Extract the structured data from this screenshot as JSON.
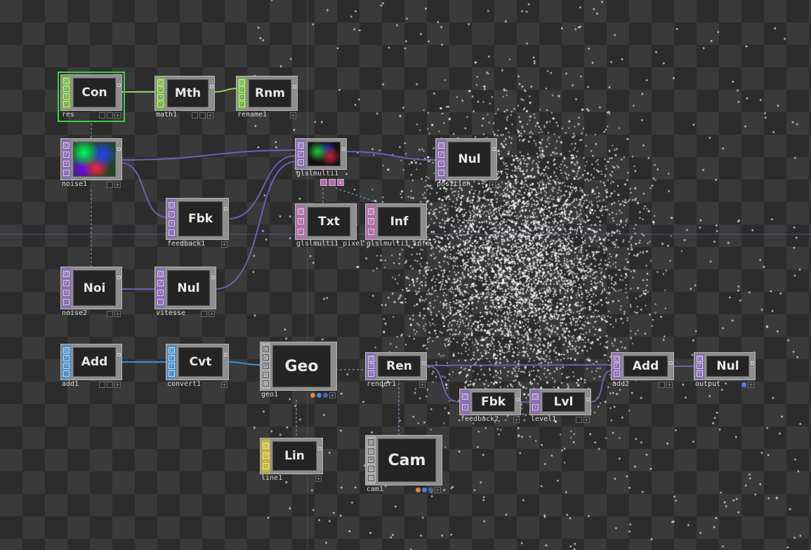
{
  "colors": {
    "chop": "#79b04d",
    "top": "#8a6eb3",
    "dat": "#b06ea8",
    "sop": "#4e8fc8",
    "mat": "#c7b23c",
    "comp": "#b0b0b0",
    "selected": "#3ecf3e",
    "wire_chop": "#8fd25a",
    "wire_top": "#6d5fb0",
    "wire_sop": "#3d8fd6",
    "wire_dashed": "#6a88a8"
  },
  "operators": [
    {
      "id": "con",
      "abbr": "Con",
      "name": "res",
      "family": "chop",
      "selected": true
    },
    {
      "id": "mth",
      "abbr": "Mth",
      "name": "math1",
      "family": "chop"
    },
    {
      "id": "rnm",
      "abbr": "Rnm",
      "name": "rename1",
      "family": "chop"
    },
    {
      "id": "noise1",
      "abbr": "",
      "name": "noise1",
      "family": "top",
      "viewer": "noise"
    },
    {
      "id": "glsl",
      "abbr": "",
      "name": "glslmulti1",
      "family": "top",
      "viewer": "glsl"
    },
    {
      "id": "position",
      "abbr": "Nul",
      "name": "position",
      "family": "top"
    },
    {
      "id": "fbk1",
      "abbr": "Fbk",
      "name": "feedback1",
      "family": "top"
    },
    {
      "id": "txt",
      "abbr": "Txt",
      "name": "glslmulti1_pixel",
      "family": "dat"
    },
    {
      "id": "inf",
      "abbr": "Inf",
      "name": "glslmulti1_info",
      "family": "dat"
    },
    {
      "id": "noi",
      "abbr": "Noi",
      "name": "noise2",
      "family": "top"
    },
    {
      "id": "vit",
      "abbr": "Nul",
      "name": "vitesse",
      "family": "top"
    },
    {
      "id": "add1",
      "abbr": "Add",
      "name": "add1",
      "family": "sop"
    },
    {
      "id": "cvt",
      "abbr": "Cvt",
      "name": "convert1",
      "family": "sop"
    },
    {
      "id": "geo",
      "abbr": "Geo",
      "name": "geo1",
      "family": "comp",
      "big": true
    },
    {
      "id": "ren",
      "abbr": "Ren",
      "name": "render1",
      "family": "top"
    },
    {
      "id": "add2",
      "abbr": "Add",
      "name": "add2",
      "family": "top"
    },
    {
      "id": "out",
      "abbr": "Nul",
      "name": "output",
      "family": "top"
    },
    {
      "id": "fbk2",
      "abbr": "Fbk",
      "name": "feedback2",
      "family": "top"
    },
    {
      "id": "lvl",
      "abbr": "Lvl",
      "name": "level1",
      "family": "top"
    },
    {
      "id": "lin",
      "abbr": "Lin",
      "name": "line1",
      "family": "mat"
    },
    {
      "id": "cam",
      "abbr": "Cam",
      "name": "cam1",
      "family": "comp",
      "big": true
    }
  ]
}
